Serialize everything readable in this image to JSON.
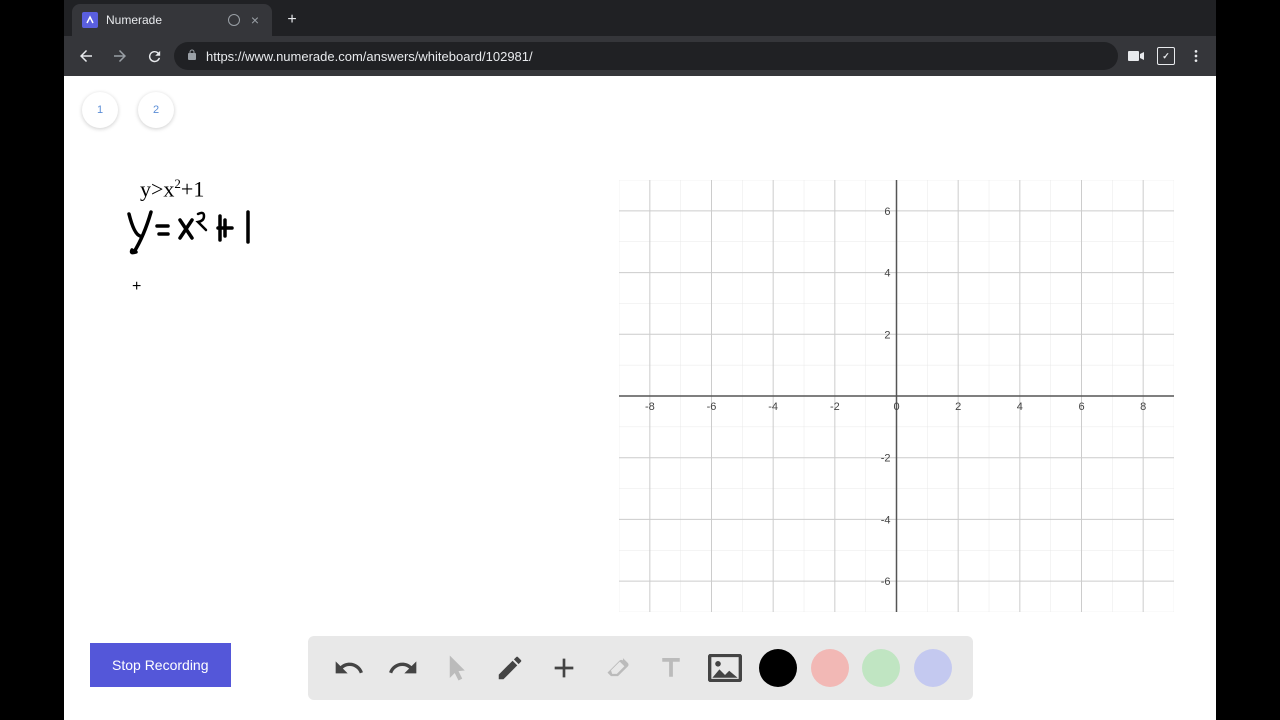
{
  "browser": {
    "tab_title": "Numerade",
    "url": "https://www.numerade.com/answers/whiteboard/102981/"
  },
  "pages": {
    "page1_label": "1",
    "page2_label": "2"
  },
  "math": {
    "typed_lhs": "y>x",
    "typed_exp": "2",
    "typed_rhs": "+1",
    "handwritten": "y= x²+1"
  },
  "chart_data": {
    "type": "scatter",
    "title": "",
    "xlabel": "",
    "ylabel": "",
    "x_ticks": [
      -8,
      -6,
      -4,
      -2,
      0,
      2,
      4,
      6,
      8
    ],
    "y_ticks": [
      -6,
      -4,
      -2,
      0,
      2,
      4,
      6
    ],
    "xlim": [
      -9,
      9
    ],
    "ylim": [
      -7,
      7
    ],
    "series": []
  },
  "toolbar": {
    "stop_label": "Stop Recording",
    "tools": {
      "undo": "undo",
      "redo": "redo",
      "pointer": "pointer",
      "pencil": "pencil",
      "plus": "plus",
      "eraser": "eraser",
      "text": "text",
      "image": "image"
    },
    "colors": {
      "black": "#000000",
      "red": "#f2b8b5",
      "green": "#c0e5c2",
      "blue": "#c4c9f0"
    }
  }
}
